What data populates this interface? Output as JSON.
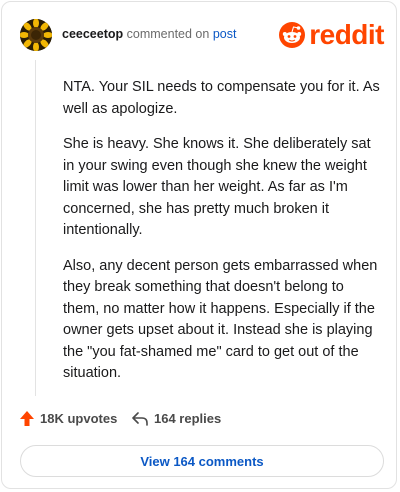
{
  "header": {
    "username": "ceeceetop",
    "action_text": "commented on",
    "post_link": "post",
    "logo_text": "reddit",
    "brand_color": "#ff4500"
  },
  "comment": {
    "paragraphs": [
      "NTA. Your SIL needs to compensate you for it. As well as apologize.",
      "She is heavy. She knows it. She deliberately sat in your swing even though she knew the weight limit was lower than her weight. As far as I'm concerned, she has pretty much broken it intentionally.",
      "Also, any decent person gets embarrassed when they break something that doesn't belong to them, no matter how it happens. Especially if the owner gets upset about it. Instead she is playing the \"you fat-shamed me\" card to get out of the situation."
    ]
  },
  "actions": {
    "upvotes": "18K upvotes",
    "replies": "164 replies",
    "upvote_icon": "upvote-arrow-icon",
    "reply_icon": "reply-arrow-icon"
  },
  "footer": {
    "view_comments": "View 164 comments"
  },
  "avatar": {
    "icon": "sunflower-avatar"
  }
}
